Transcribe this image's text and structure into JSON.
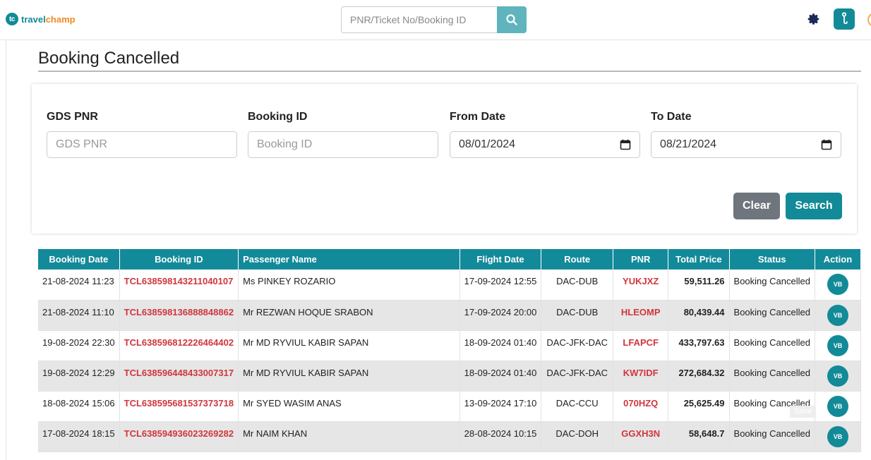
{
  "header": {
    "logo_badge": "tc",
    "logo_part1": "travel",
    "logo_part2": "champ",
    "search_placeholder": "PNR/Ticket No/Booking ID"
  },
  "page": {
    "title": "Booking Cancelled"
  },
  "filters": {
    "gds_pnr": {
      "label": "GDS PNR",
      "placeholder": "GDS PNR"
    },
    "booking_id": {
      "label": "Booking ID",
      "placeholder": "Booking ID"
    },
    "from_date": {
      "label": "From Date",
      "value": "08/01/2024"
    },
    "to_date": {
      "label": "To Date",
      "value": "08/21/2024"
    },
    "clear_label": "Clear",
    "search_label": "Search"
  },
  "table": {
    "headers": [
      "Booking Date",
      "Booking ID",
      "Passenger Name",
      "Flight Date",
      "Route",
      "PNR",
      "Total Price",
      "Status",
      "Action"
    ],
    "rows": [
      [
        "21-08-2024 11:23",
        "TCL638598143211040107",
        "Ms PINKEY ROZARIO",
        "17-09-2024 12:55",
        "DAC-DUB",
        "YUKJXZ",
        "59,511.26",
        "Booking Cancelled",
        "VB"
      ],
      [
        "21-08-2024 11:10",
        "TCL638598136888848862",
        "Mr REZWAN HOQUE SRABON",
        "17-09-2024 20:00",
        "DAC-DUB",
        "HLEOMP",
        "80,439.44",
        "Booking Cancelled",
        "VB"
      ],
      [
        "19-08-2024 22:30",
        "TCL638596812226464402",
        "Mr MD RYVIUL KABIR SAPAN",
        "18-09-2024 01:40",
        "DAC-JFK-DAC",
        "LFAPCF",
        "433,797.63",
        "Booking Cancelled",
        "VB"
      ],
      [
        "19-08-2024 12:29",
        "TCL638596448433007317",
        "Mr MD RYVIUL KABIR SAPAN",
        "18-09-2024 01:40",
        "DAC-JFK-DAC",
        "KW7IDF",
        "272,684.32",
        "Booking Cancelled",
        "VB"
      ],
      [
        "18-08-2024 15:06",
        "TCL638595681537373718",
        "Mr SYED WASIM ANAS",
        "13-09-2024 17:10",
        "DAC-CCU",
        "070HZQ",
        "25,625.49",
        "Booking Cancelled",
        "VB"
      ],
      [
        "17-08-2024 18:15",
        "TCL638594936023269282",
        "Mr NAIM KHAN",
        "28-08-2024 10:15",
        "DAC-DOH",
        "GGXH3N",
        "58,648.7",
        "Booking Cancelled",
        "VB"
      ]
    ]
  },
  "tooltip": {
    "save": "Save"
  },
  "colors": {
    "accent": "#128a97",
    "pnr_red": "#d0363d",
    "clear_gray": "#6e757c"
  }
}
